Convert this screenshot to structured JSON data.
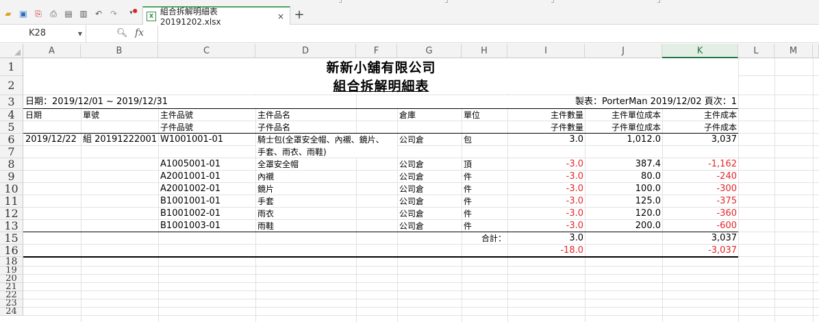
{
  "toolbar": {
    "icons": [
      "open-folder-icon",
      "save-icon",
      "export-pdf-icon",
      "print-icon",
      "print-preview-icon",
      "page-preview-icon",
      "undo-icon",
      "redo-icon",
      "customize-dropdown-icon"
    ],
    "tab_title": "組合拆解明細表20191202.xlsx",
    "tab_close": "×",
    "new_tab": "+"
  },
  "formula_bar": {
    "name_box": "K28",
    "fx_label": "fx",
    "formula": ""
  },
  "columns": [
    "A",
    "B",
    "C",
    "D",
    "F",
    "G",
    "H",
    "I",
    "J",
    "K",
    "L",
    "M"
  ],
  "selected_column": "K",
  "rows": [
    "1",
    "2",
    "3",
    "4",
    "5",
    "6",
    "7",
    "8",
    "9",
    "10",
    "11",
    "12",
    "13",
    "15",
    "16",
    "18",
    "19",
    "20",
    "21",
    "22",
    "23",
    "24"
  ],
  "report": {
    "company": "新新小舖有限公司",
    "title": "組合拆解明細表",
    "date_range": "日期：2019/12/01 ~ 2019/12/31",
    "made_by": "製表：PorterMan 2019/12/02  頁次：1",
    "headers_row1": {
      "date": "日期",
      "doc_no": "單號",
      "main_item_no": "主件品號",
      "main_item_name": "主件品名",
      "warehouse": "倉庫",
      "unit": "單位",
      "main_qty": "主件數量",
      "main_unit_cost": "主件單位成本",
      "main_cost": "主件成本"
    },
    "headers_row2": {
      "sub_item_no": "子件品號",
      "sub_item_name": "子件品名",
      "sub_qty": "子件數量",
      "sub_unit_cost": "子件單位成本",
      "sub_cost": "子件成本"
    },
    "main_row": {
      "date": "2019/12/22",
      "doc_no": "組 20191222001",
      "item_no": "W1001001-01",
      "item_name_line1": "騎士包(全罩安全帽、內襯、鏡片、",
      "item_name_line2": "手套、雨衣、雨鞋)",
      "warehouse": "公司倉",
      "unit": "包",
      "qty": "3.0",
      "unit_cost": "1,012.0",
      "cost": "3,037"
    },
    "sub_rows": [
      {
        "item_no": "A1005001-01",
        "item_name": "全罩安全帽",
        "warehouse": "公司倉",
        "unit": "頂",
        "qty": "-3.0",
        "unit_cost": "387.4",
        "cost": "-1,162"
      },
      {
        "item_no": "A2001001-01",
        "item_name": "內襯",
        "warehouse": "公司倉",
        "unit": "件",
        "qty": "-3.0",
        "unit_cost": "80.0",
        "cost": "-240"
      },
      {
        "item_no": "A2001002-01",
        "item_name": "鏡片",
        "warehouse": "公司倉",
        "unit": "件",
        "qty": "-3.0",
        "unit_cost": "100.0",
        "cost": "-300"
      },
      {
        "item_no": "B1001001-01",
        "item_name": "手套",
        "warehouse": "公司倉",
        "unit": "件",
        "qty": "-3.0",
        "unit_cost": "125.0",
        "cost": "-375"
      },
      {
        "item_no": "B1001002-01",
        "item_name": "雨衣",
        "warehouse": "公司倉",
        "unit": "件",
        "qty": "-3.0",
        "unit_cost": "120.0",
        "cost": "-360"
      },
      {
        "item_no": "B1001003-01",
        "item_name": "雨鞋",
        "warehouse": "公司倉",
        "unit": "件",
        "qty": "-3.0",
        "unit_cost": "200.0",
        "cost": "-600"
      }
    ],
    "total": {
      "label": "合計：",
      "main_qty": "3.0",
      "main_cost": "3,037",
      "sub_qty": "-18.0",
      "sub_cost": "-3,037"
    }
  },
  "colors": {
    "negative": "#e0262a",
    "accent": "#217346",
    "header_bg": "#f3f3f3"
  }
}
